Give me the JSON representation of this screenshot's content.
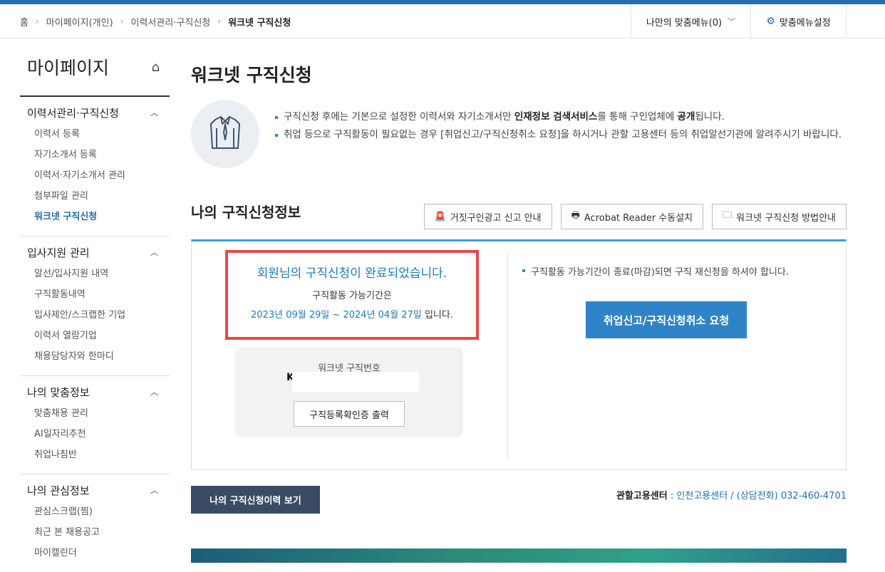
{
  "breadcrumb": {
    "items": [
      "홈",
      "마이페이지(개인)",
      "이력서관리·구직신청",
      "워크넷 구직신청"
    ]
  },
  "header": {
    "my_menu_label": "나만의 맞춤메뉴(0)",
    "menu_settings_label": "맞춤메뉴설정"
  },
  "sidebar": {
    "title": "마이페이지",
    "groups": [
      {
        "title": "이력서관리·구직신청",
        "items": [
          "이력서 등록",
          "자기소개서 등록",
          "이력서·자기소개서 관리",
          "첨부파일 관리",
          "워크넷 구직신청"
        ],
        "active_index": 4
      },
      {
        "title": "입사지원 관리",
        "items": [
          "알선/입사지원 내역",
          "구직활동내역",
          "입사제안/스크랩한 기업",
          "이력서 열람기업",
          "채용담당자와 한마디"
        ]
      },
      {
        "title": "나의 맞춤정보",
        "items": [
          "맞춤채용 관리",
          "AI일자리추천",
          "취업나침반"
        ]
      },
      {
        "title": "나의 관심정보",
        "items": [
          "관심스크랩(찜)",
          "최근 본 채용공고",
          "마이캘린더"
        ]
      }
    ]
  },
  "main": {
    "title": "워크넷 구직신청",
    "info": {
      "line1_a": "구직신청 후에는 기본으로 설정한 이력서와 자기소개서만 ",
      "line1_b": "인재정보 검색서비스",
      "line1_c": "를 통해 구인업체에 ",
      "line1_d": "공개",
      "line1_e": "됩니다.",
      "line2": "취업 등으로 구직활동이 필요없는 경우 [취업신고/구직신청취소 요청]을 하시거나 관할 고용센터 등의 취업알선기관에 알려주시기 바랍니다."
    },
    "section_title": "나의 구직신청정보",
    "buttons": {
      "fake_ad": "거짓구인광고 신고 안내",
      "acrobat": "Acrobat Reader 수동설치",
      "guide": "워크넷 구직신청 방법안내"
    },
    "status": {
      "done_message": "회원님의 구직신청이 완료되었습니다.",
      "period_label": "구직활동 가능기간은",
      "period_dates": "2023년 09월 29일 ~ 2024년 04월 27일",
      "period_suffix": " 입니다."
    },
    "number": {
      "label": "워크넷 구직번호",
      "value": "K",
      "print_button": "구직등록확인증 출력"
    },
    "right": {
      "note": "구직활동 가능기간이 종료(마감)되면 구직 재신청을 하셔야 합니다.",
      "cancel_button": "취업신고/구직신청취소 요청"
    },
    "history_button": "나의 구직신청이력 보기",
    "center": {
      "label": "관할고용센터",
      "sep": " : ",
      "value": "인천고용센터 / (상담전화) 032-460-4701"
    }
  },
  "colors": {
    "accent": "#2a6bb8",
    "highlight_border": "#e8474c",
    "primary_button": "#2f84c8",
    "dark_button": "#3b4b63"
  }
}
